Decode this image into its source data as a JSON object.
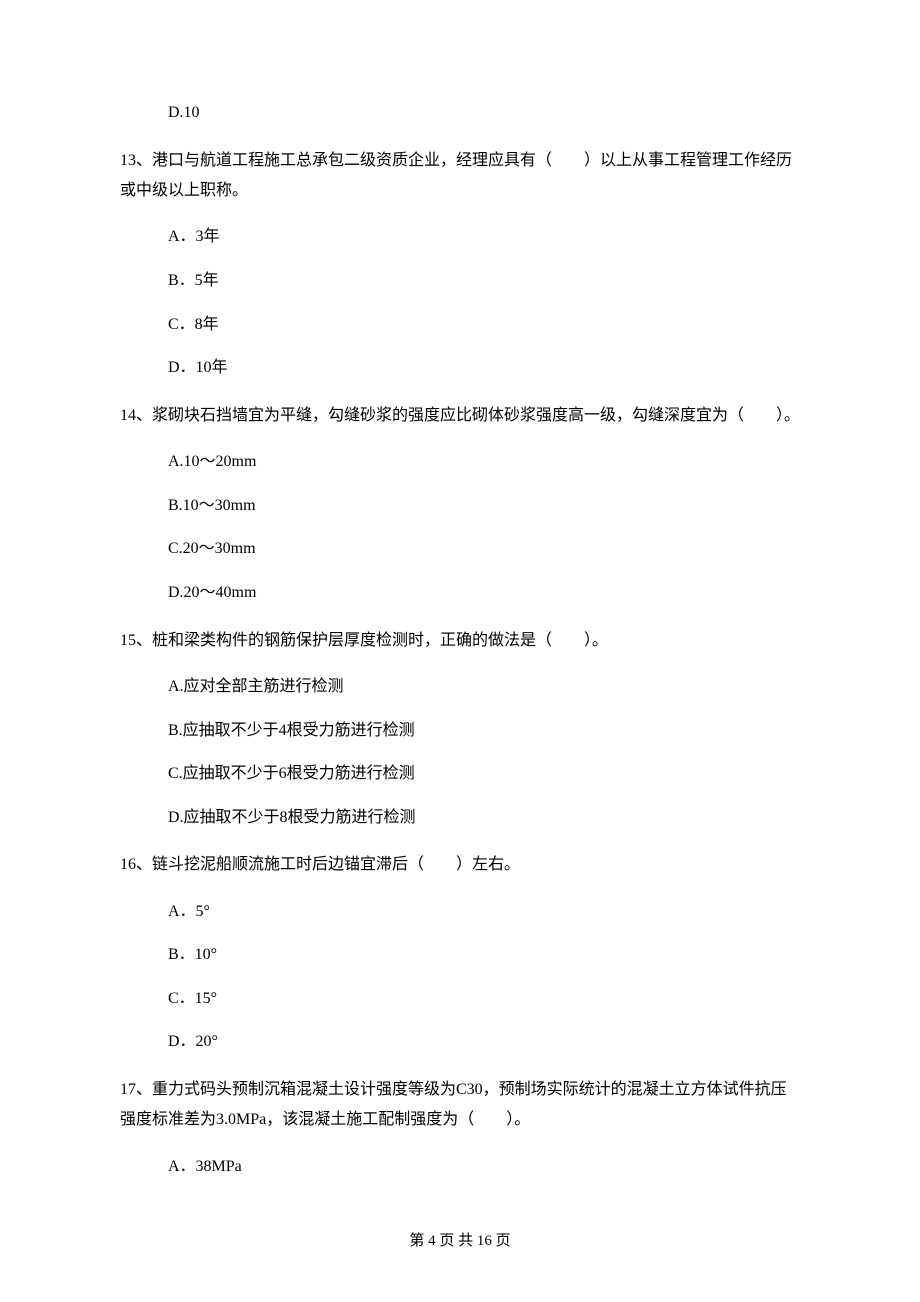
{
  "q12": {
    "optD": "D.10"
  },
  "q13": {
    "text": "13、港口与航道工程施工总承包二级资质企业，经理应具有（　　）以上从事工程管理工作经历或中级以上职称。",
    "optA": "A．3年",
    "optB": "B．5年",
    "optC": "C．8年",
    "optD": "D．10年"
  },
  "q14": {
    "text": "14、浆砌块石挡墙宜为平缝，勾缝砂浆的强度应比砌体砂浆强度高一级，勾缝深度宜为（　　）。",
    "optA": "A.10～20mm",
    "optB": "B.10～30mm",
    "optC": "C.20～30mm",
    "optD": "D.20～40mm"
  },
  "q15": {
    "text": "15、桩和梁类构件的钢筋保护层厚度检测时，正确的做法是（　　）。",
    "optA": "A.应对全部主筋进行检测",
    "optB": "B.应抽取不少于4根受力筋进行检测",
    "optC": "C.应抽取不少于6根受力筋进行检测",
    "optD": "D.应抽取不少于8根受力筋进行检测"
  },
  "q16": {
    "text": "16、链斗挖泥船顺流施工时后边锚宜滞后（　　）左右。",
    "optA": "A．5°",
    "optB": "B．10°",
    "optC": "C．15°",
    "optD": "D．20°"
  },
  "q17": {
    "text": "17、重力式码头预制沉箱混凝土设计强度等级为C30，预制场实际统计的混凝土立方体试件抗压强度标准差为3.0MPa，该混凝土施工配制强度为（　　）。",
    "optA": "A．38MPa"
  },
  "footer": "第 4 页 共 16 页"
}
